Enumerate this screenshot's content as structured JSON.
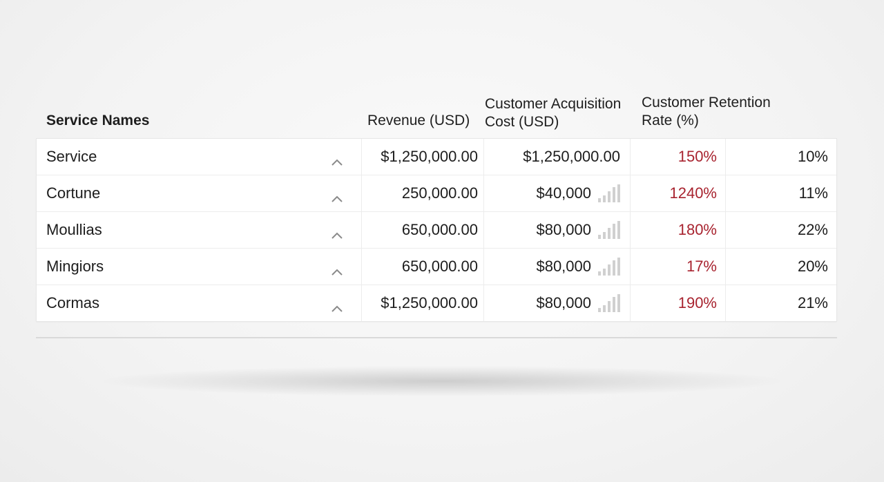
{
  "headers": {
    "service_names": "Service Names",
    "revenue": "Revenue (USD)",
    "cac": "Customer Acquisition Cost (USD)",
    "retention": "Customer Retention Rate (%)"
  },
  "rows": [
    {
      "name": "Service",
      "revenue": "$1,250,000.00",
      "cac": "$1,250,000.00",
      "retention": "150%",
      "last": "10%",
      "has_bars": false
    },
    {
      "name": "Cortune",
      "revenue": "250,000.00",
      "cac": "$40,000",
      "retention": "1240%",
      "last": "11%",
      "has_bars": true
    },
    {
      "name": "Moullias",
      "revenue": "650,000.00",
      "cac": "$80,000",
      "retention": "180%",
      "last": "22%",
      "has_bars": true
    },
    {
      "name": "Mingiors",
      "revenue": "650,000.00",
      "cac": "$80,000",
      "retention": "17%",
      "last": "20%",
      "has_bars": true
    },
    {
      "name": "Cormas",
      "revenue": "$1,250,000.00",
      "cac": "$80,000",
      "retention": "190%",
      "last": "21%",
      "has_bars": true
    }
  ],
  "icons": {
    "row_toggle": "chevron-up-icon",
    "sparkline": "bar-chart-icon"
  },
  "colors": {
    "retention_text": "#a8232f",
    "bars": "#d0d0d0"
  }
}
